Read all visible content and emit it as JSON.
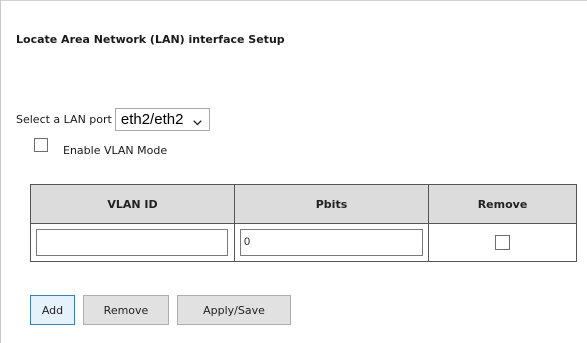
{
  "page": {
    "title": "Locate Area Network (LAN) interface Setup"
  },
  "lan_port": {
    "label": "Select a LAN port",
    "selected": "eth2/eth2"
  },
  "vlan_mode": {
    "label": "Enable VLAN Mode",
    "checked": false
  },
  "vlan_table": {
    "headers": [
      "VLAN ID",
      "Pbits",
      "Remove"
    ],
    "rows": [
      {
        "vlan_id": "",
        "pbits": "0",
        "remove": false
      }
    ]
  },
  "buttons": {
    "add": "Add",
    "remove": "Remove",
    "apply_save": "Apply/Save"
  },
  "colors": {
    "header_bg": "#dcdcdc",
    "table_border": "#555555",
    "focus_border": "#3c7fb1"
  },
  "icons": {
    "select_arrow": "chevron-down-icon"
  }
}
